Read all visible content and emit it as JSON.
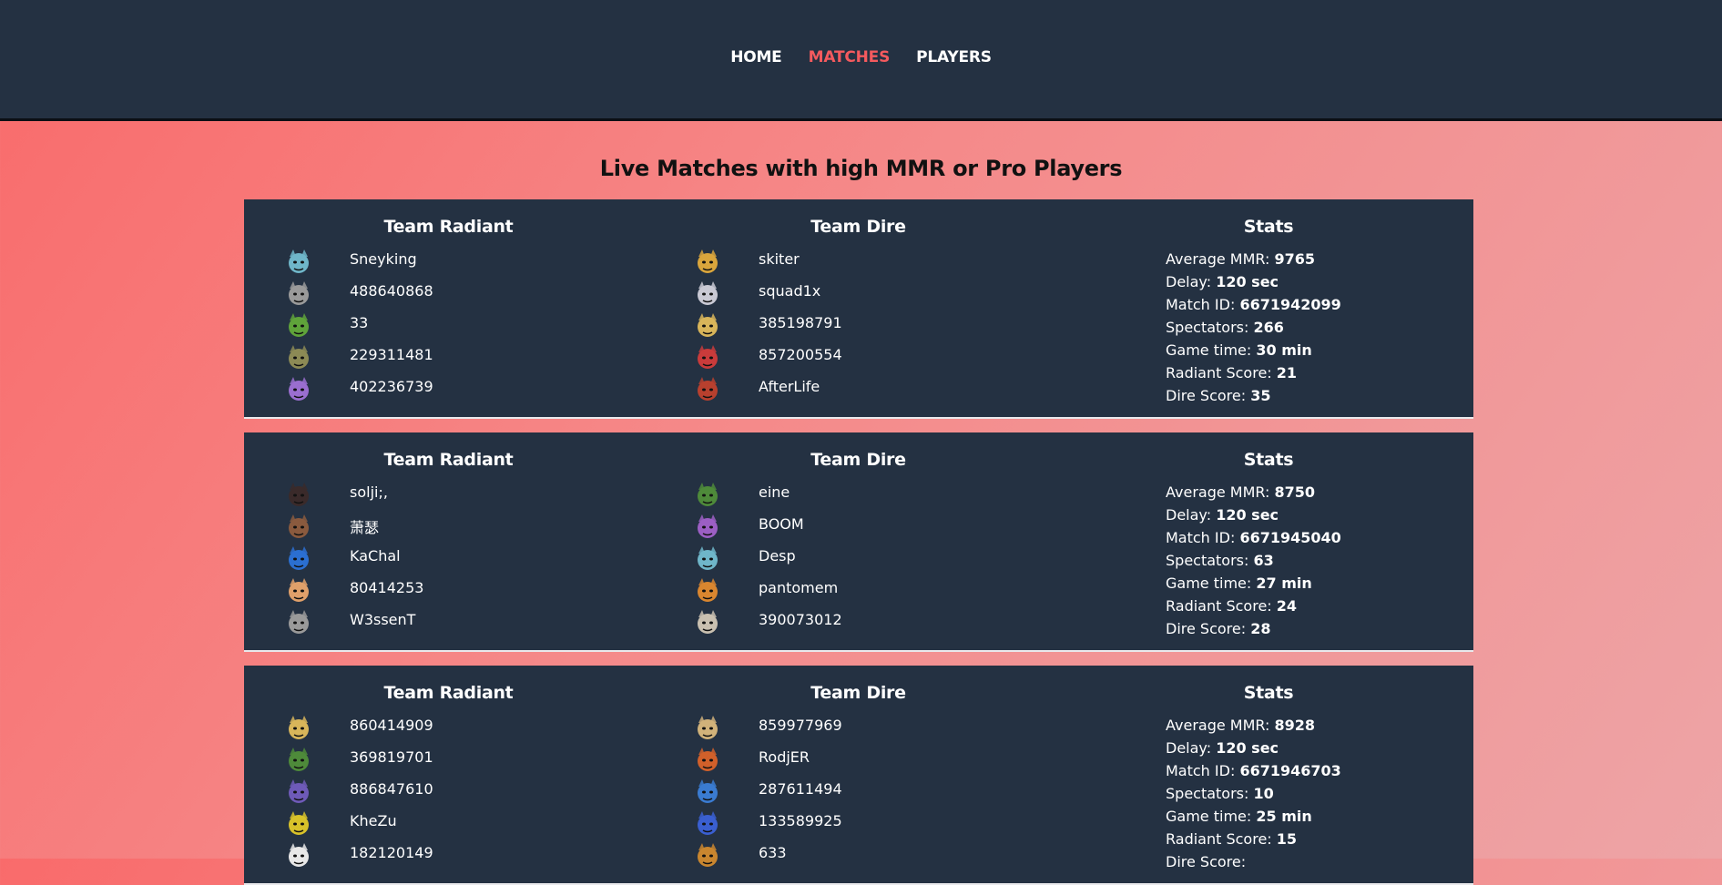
{
  "nav": {
    "home": "HOME",
    "matches": "MATCHES",
    "players": "PLAYERS",
    "active_color": "#f45a5e"
  },
  "page_title": "Live Matches with high MMR or Pro Players",
  "labels": {
    "radiant": "Team Radiant",
    "dire": "Team Dire",
    "stats": "Stats",
    "avg_mmr": "Average MMR:",
    "delay": "Delay:",
    "match_id": "Match ID:",
    "spectators": "Spectators:",
    "game_time": "Game time:",
    "radiant_score": "Radiant Score:",
    "dire_score": "Dire Score:"
  },
  "matches": [
    {
      "radiant": [
        {
          "name": "Sneyking",
          "hero_icon": "hero-icon-teal-dragon",
          "color": "#6fb6c9"
        },
        {
          "name": "488640868",
          "hero_icon": "hero-icon-grey-horned",
          "color": "#9a9a9a"
        },
        {
          "name": "33",
          "hero_icon": "hero-icon-green-goblin",
          "color": "#5fa33a"
        },
        {
          "name": "229311481",
          "hero_icon": "hero-icon-olive-brute",
          "color": "#8c8a55"
        },
        {
          "name": "402236739",
          "hero_icon": "hero-icon-purple-void",
          "color": "#9a6ecf"
        }
      ],
      "dire": [
        {
          "name": "skiter",
          "hero_icon": "hero-icon-gold-crown",
          "color": "#d9a53c"
        },
        {
          "name": "squad1x",
          "hero_icon": "hero-icon-white-beard",
          "color": "#c9c9d4"
        },
        {
          "name": "385198791",
          "hero_icon": "hero-icon-gold-mask",
          "color": "#d8b55a"
        },
        {
          "name": "857200554",
          "hero_icon": "hero-icon-red-demon",
          "color": "#c93b3b"
        },
        {
          "name": "AfterLife",
          "hero_icon": "hero-icon-red-hair",
          "color": "#b8402e"
        }
      ],
      "stats": {
        "avg_mmr": "9765",
        "delay": "120 sec",
        "match_id": "6671942099",
        "spectators": "266",
        "game_time": "30 min",
        "radiant_score": "21",
        "dire_score": "35"
      }
    },
    {
      "radiant": [
        {
          "name": "solji;,",
          "hero_icon": "hero-icon-dark-demon",
          "color": "#3a2a2a"
        },
        {
          "name": "萧瑟",
          "hero_icon": "hero-icon-brown-ogre",
          "color": "#8a5a3e"
        },
        {
          "name": "KaChal",
          "hero_icon": "hero-icon-blue-beast",
          "color": "#2b6fd1"
        },
        {
          "name": "80414253",
          "hero_icon": "hero-icon-blonde-queen",
          "color": "#e0a06a"
        },
        {
          "name": "W3ssenT",
          "hero_icon": "hero-icon-grey-horned",
          "color": "#9a9a9a"
        }
      ],
      "dire": [
        {
          "name": "eine",
          "hero_icon": "hero-icon-green-hood",
          "color": "#4e8a3a"
        },
        {
          "name": "BOOM",
          "hero_icon": "hero-icon-purple-witch",
          "color": "#9c5fc4"
        },
        {
          "name": "Desp",
          "hero_icon": "hero-icon-teal-dragon",
          "color": "#6fb6c9"
        },
        {
          "name": "pantomem",
          "hero_icon": "hero-icon-orange-monkey",
          "color": "#d9862f"
        },
        {
          "name": "390073012",
          "hero_icon": "hero-icon-skull-ninja",
          "color": "#c9c0b0"
        }
      ],
      "stats": {
        "avg_mmr": "8750",
        "delay": "120 sec",
        "match_id": "6671945040",
        "spectators": "63",
        "game_time": "27 min",
        "radiant_score": "24",
        "dire_score": "28"
      }
    },
    {
      "radiant": [
        {
          "name": "860414909",
          "hero_icon": "hero-icon-gold-mask",
          "color": "#d8b55a"
        },
        {
          "name": "369819701",
          "hero_icon": "hero-icon-green-hood",
          "color": "#4e8a3a"
        },
        {
          "name": "886847610",
          "hero_icon": "hero-icon-purple-mage",
          "color": "#6e5ab8"
        },
        {
          "name": "KheZu",
          "hero_icon": "hero-icon-yellow-red",
          "color": "#d8c22a"
        },
        {
          "name": "182120149",
          "hero_icon": "hero-icon-white-orb",
          "color": "#e8e8e8"
        }
      ],
      "dire": [
        {
          "name": "859977969",
          "hero_icon": "hero-icon-bald-monk",
          "color": "#d1b27a"
        },
        {
          "name": "RodjER",
          "hero_icon": "hero-icon-fire-spirit",
          "color": "#d1602a"
        },
        {
          "name": "287611494",
          "hero_icon": "hero-icon-blue-claw",
          "color": "#3a7bd1"
        },
        {
          "name": "133589925",
          "hero_icon": "hero-icon-blue-masked",
          "color": "#3a5fd1"
        },
        {
          "name": "633",
          "hero_icon": "hero-icon-orange-brute",
          "color": "#c9862f"
        }
      ],
      "stats": {
        "avg_mmr": "8928",
        "delay": "120 sec",
        "match_id": "6671946703",
        "spectators": "10",
        "game_time": "25 min",
        "radiant_score": "15",
        "dire_score": ""
      }
    }
  ]
}
